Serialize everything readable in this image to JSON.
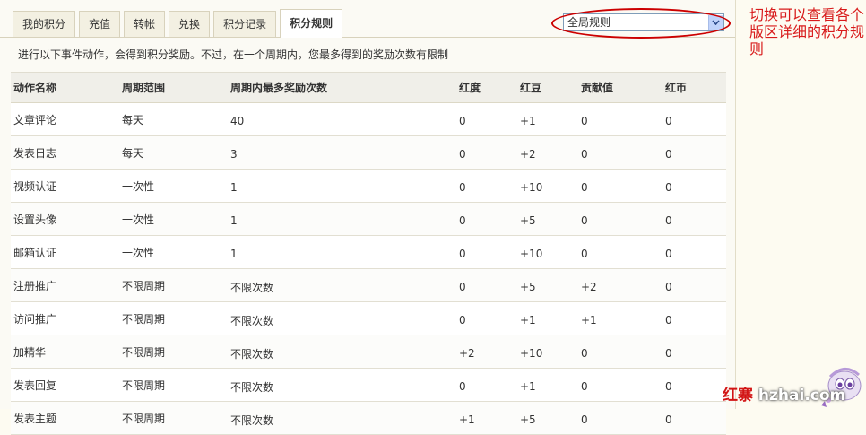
{
  "tabs": [
    "我的积分",
    "充值",
    "转帐",
    "兑换",
    "积分记录",
    "积分规则"
  ],
  "active_tab_index": 5,
  "rule_select": {
    "value": "全局规则"
  },
  "annotation_note": "切换可以查看各个版区详细的积分规则",
  "intro": "进行以下事件动作，会得到积分奖励。不过，在一个周期内，您最多得到的奖励次数有限制",
  "table": {
    "headers": [
      "动作名称",
      "周期范围",
      "周期内最多奖励次数",
      "红度",
      "红豆",
      "贡献值",
      "红币"
    ],
    "rows": [
      [
        "文章评论",
        "每天",
        "40",
        "0",
        "+1",
        "0",
        "0"
      ],
      [
        "发表日志",
        "每天",
        "3",
        "0",
        "+2",
        "0",
        "0"
      ],
      [
        "视频认证",
        "一次性",
        "1",
        "0",
        "+10",
        "0",
        "0"
      ],
      [
        "设置头像",
        "一次性",
        "1",
        "0",
        "+5",
        "0",
        "0"
      ],
      [
        "邮箱认证",
        "一次性",
        "1",
        "0",
        "+10",
        "0",
        "0"
      ],
      [
        "注册推广",
        "不限周期",
        "不限次数",
        "0",
        "+5",
        "+2",
        "0"
      ],
      [
        "访问推广",
        "不限周期",
        "不限次数",
        "0",
        "+1",
        "+1",
        "0"
      ],
      [
        "加精华",
        "不限周期",
        "不限次数",
        "+2",
        "+10",
        "0",
        "0"
      ],
      [
        "发表回复",
        "不限周期",
        "不限次数",
        "0",
        "+1",
        "0",
        "0"
      ],
      [
        "发表主题",
        "不限周期",
        "不限次数",
        "+1",
        "+5",
        "0",
        "0"
      ]
    ]
  },
  "watermark": {
    "cn": "红寨",
    "en": "hzhai.com"
  }
}
